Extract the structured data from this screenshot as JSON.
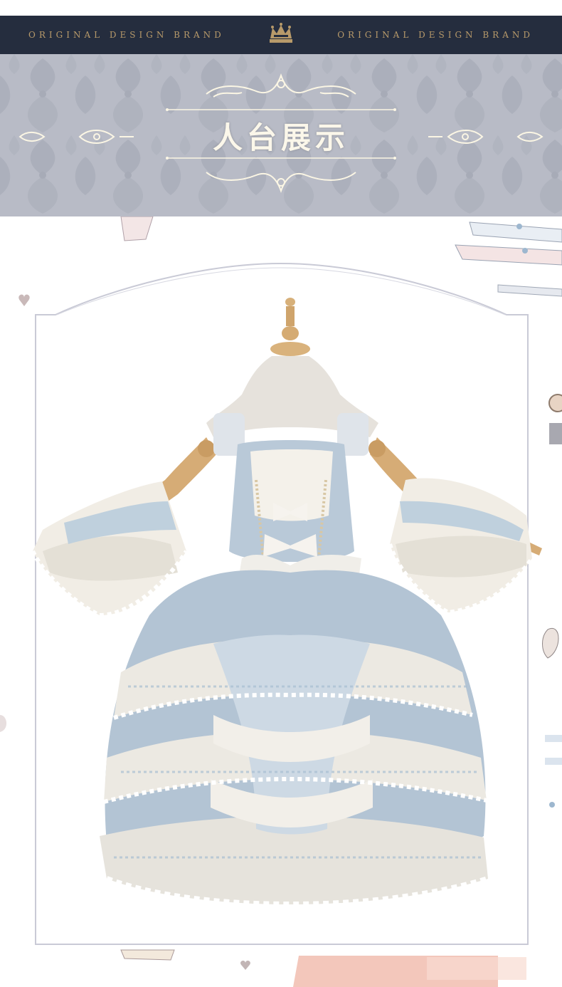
{
  "header": {
    "left_brand": "ORIGINAL DESIGN BRAND",
    "right_brand": "ORIGINAL DESIGN BRAND",
    "crown_icon": "crown-icon"
  },
  "banner": {
    "title": "人台展示"
  },
  "colors": {
    "brand_bar": "#252d3e",
    "brand_text": "#b89a6a",
    "damask_bg": "#b4b7c3",
    "title_text": "#fbf7ea",
    "frame_line": "#c9cad6",
    "dress_blue": "#b9c9d8"
  }
}
